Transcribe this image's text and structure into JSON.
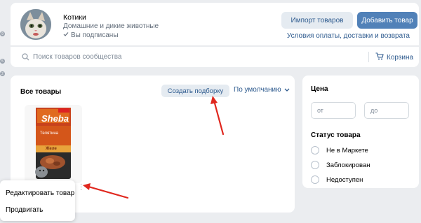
{
  "header": {
    "group_name": "Котики",
    "group_category": "Домашние и дикие животные",
    "subscribed_label": "Вы подписаны",
    "import_button": "Импорт товаров",
    "add_button": "Добавить товар",
    "terms_link": "Условия оплаты, доставки и возврата"
  },
  "search": {
    "placeholder": "Поиск товаров сообщества",
    "cart_label": "Корзина"
  },
  "main": {
    "section_title": "Все товары",
    "create_collection_button": "Создать подборку",
    "sort_label": "По умолчанию",
    "product": {
      "brand": "Sheba",
      "flavor": "Телятина",
      "sauce": "Желе"
    }
  },
  "context_menu": {
    "items": [
      "Редактировать товар",
      "Продвигать"
    ]
  },
  "filters": {
    "price_title": "Цена",
    "price_from_placeholder": "от",
    "price_to_placeholder": "до",
    "status_title": "Статус товара",
    "status_options": [
      "Не в Маркете",
      "Заблокирован",
      "Недоступен"
    ]
  },
  "left_badges": [
    "9",
    "5",
    "2"
  ],
  "colors": {
    "primary": "#5181b8",
    "link": "#2d5a8e",
    "background": "#ebedf0",
    "arrow": "#e0271e"
  }
}
